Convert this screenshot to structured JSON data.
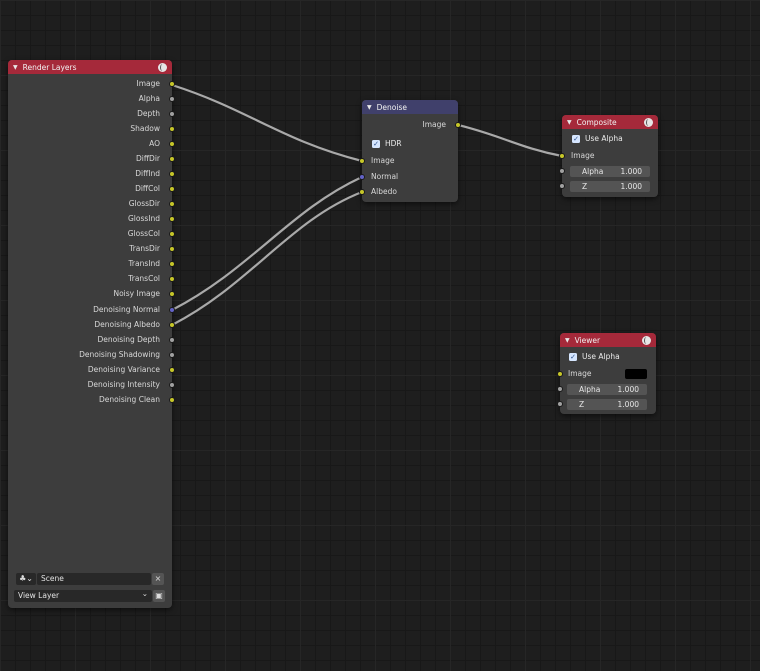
{
  "render_layers": {
    "title": "Render Layers",
    "outputs": [
      "Image",
      "Alpha",
      "Depth",
      "Shadow",
      "AO",
      "DiffDir",
      "DiffInd",
      "DiffCol",
      "GlossDir",
      "GlossInd",
      "GlossCol",
      "TransDir",
      "TransInd",
      "TransCol",
      "Noisy Image",
      "Denoising Normal",
      "Denoising Albedo",
      "Denoising Depth",
      "Denoising Shadowing",
      "Denoising Variance",
      "Denoising Intensity",
      "Denoising Clean"
    ],
    "scene": "Scene",
    "view_layer": "View Layer",
    "clear_icon": "×",
    "dropdown_icon": "⌄"
  },
  "denoise": {
    "title": "Denoise",
    "output": "Image",
    "hdr_label": "HDR",
    "hdr_checked": true,
    "inputs": [
      "Image",
      "Normal",
      "Albedo"
    ]
  },
  "composite": {
    "title": "Composite",
    "use_alpha_label": "Use Alpha",
    "use_alpha_checked": true,
    "image_label": "Image",
    "alpha_label": "Alpha",
    "alpha_value": "1.000",
    "z_label": "Z",
    "z_value": "1.000"
  },
  "viewer": {
    "title": "Viewer",
    "use_alpha_label": "Use Alpha",
    "use_alpha_checked": true,
    "image_label": "Image",
    "alpha_label": "Alpha",
    "alpha_value": "1.000",
    "z_label": "Z",
    "z_value": "1.000"
  },
  "icons": {
    "node_collapse": "chevron-down-icon",
    "node_preview": "globe-icon",
    "scene": "scene-icon",
    "checkbox": "checkmark-icon",
    "browse": "folder-icon"
  },
  "colors": {
    "output_header": "#a5293a",
    "filter_header": "#40406b",
    "socket_color": "#c7c729",
    "socket_float": "#a1a1a1",
    "socket_vector": "#6363c7",
    "link": "#a9a9a9"
  }
}
